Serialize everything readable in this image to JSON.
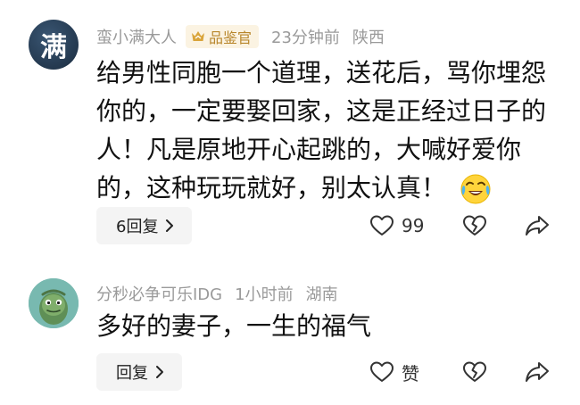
{
  "comments": [
    {
      "username": "蛮小满大人",
      "avatar_char": "满",
      "badge": "品鉴官",
      "time": "23分钟前",
      "location": "陕西",
      "text": "给男性同胞一个道理，送花后，骂你埋怨你的，一定要娶回家，这是正经过日子的人！凡是原地开心起跳的，大喊好爱你的，这种玩玩就好，别太认真！",
      "emoji": "crying-laughing-emoji",
      "reply_label": "6回复",
      "like_count": "99"
    },
    {
      "username": "分秒必争可乐IDG",
      "time": "1小时前",
      "location": "湖南",
      "text": "多好的妻子，一生的福气",
      "reply_label": "回复",
      "like_count": "赞"
    }
  ],
  "icons": {
    "badge": "badge-crown-icon",
    "chevron": "chevron-right-icon",
    "like": "heart-outline-icon",
    "dislike": "broken-heart-icon",
    "share": "share-arrow-icon"
  },
  "colors": {
    "meta_text": "#9a9a9a",
    "badge_bg": "#fbf3e2",
    "badge_text": "#b8862b",
    "reply_bg": "#f4f4f4"
  }
}
